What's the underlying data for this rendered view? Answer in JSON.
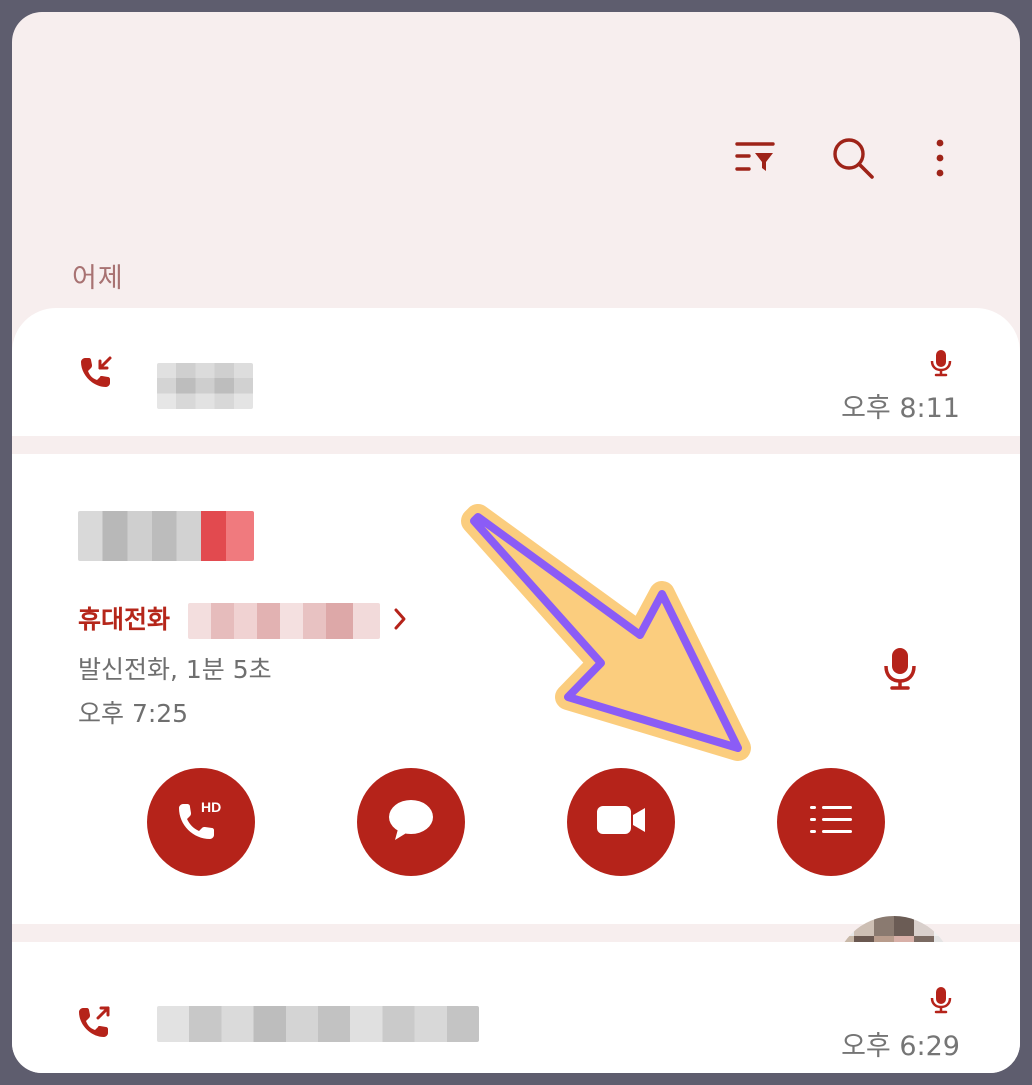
{
  "colors": {
    "accent": "#b5231a",
    "background": "#f7eeee",
    "card": "#ffffff",
    "muted_text": "#757575",
    "section_label": "#a87272",
    "annotation_fill": "#fbcd7e",
    "annotation_stroke": "#8b5cf6"
  },
  "toolbar": {
    "icons": [
      "filter-icon",
      "search-icon",
      "more-vert-icon"
    ]
  },
  "section": {
    "label": "어제"
  },
  "calls": [
    {
      "direction_icon": "incoming-call-icon",
      "has_recording": true,
      "time": "오후 8:11"
    },
    {
      "expanded": true,
      "number_type": "휴대전화",
      "detail": "발신전화, 1분 5초",
      "time": "오후 7:25",
      "has_recording": true,
      "actions": [
        {
          "icon": "hd-call-icon"
        },
        {
          "icon": "message-icon"
        },
        {
          "icon": "video-call-icon"
        },
        {
          "icon": "details-list-icon"
        }
      ]
    },
    {
      "direction_icon": "outgoing-call-icon",
      "has_recording": true,
      "time": "오후 6:29"
    }
  ],
  "annotation": {
    "icon": "annotation-arrow-icon"
  }
}
